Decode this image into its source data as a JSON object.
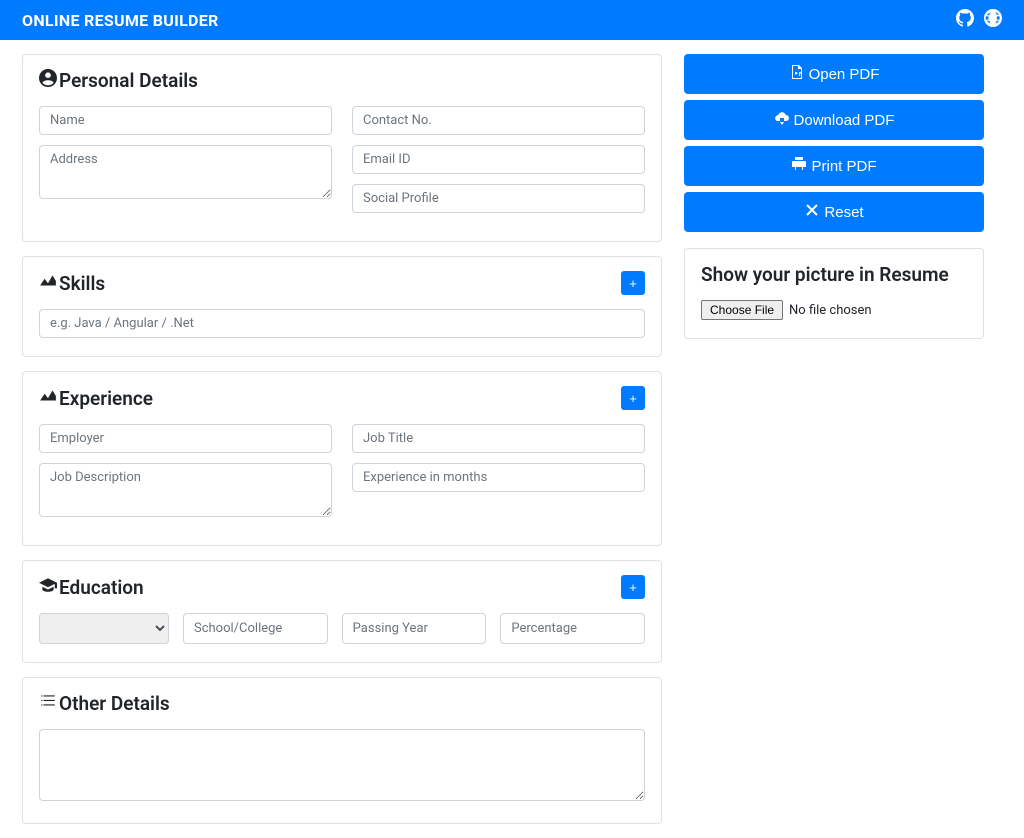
{
  "navbar": {
    "brand": "ONLINE RESUME BUILDER"
  },
  "buttons": {
    "open_pdf": "Open PDF",
    "download_pdf": "Download PDF",
    "print_pdf": "Print PDF",
    "reset": "Reset",
    "add": "+"
  },
  "picture": {
    "title": "Show your picture in Resume",
    "choose": "Choose File",
    "no_file": "No file chosen"
  },
  "sections": {
    "personal": {
      "title": "Personal Details",
      "name_ph": "Name",
      "address_ph": "Address",
      "contact_ph": "Contact No.",
      "email_ph": "Email ID",
      "social_ph": "Social Profile"
    },
    "skills": {
      "title": "Skills",
      "skill_ph": "e.g. Java / Angular / .Net"
    },
    "experience": {
      "title": "Experience",
      "employer_ph": "Employer",
      "jobdesc_ph": "Job Description",
      "jobtitle_ph": "Job Title",
      "months_ph": "Experience in months"
    },
    "education": {
      "title": "Education",
      "school_ph": "School/College",
      "year_ph": "Passing Year",
      "percent_ph": "Percentage"
    },
    "other": {
      "title": "Other Details"
    }
  }
}
